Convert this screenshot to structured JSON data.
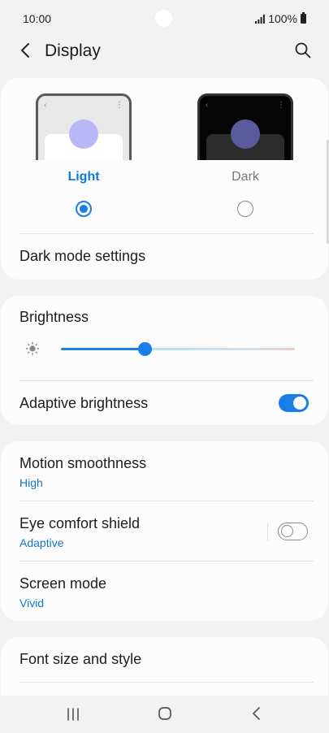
{
  "status_bar": {
    "time": "10:00",
    "battery": "100%",
    "icons": [
      "signal-icon",
      "battery-icon"
    ]
  },
  "app_bar": {
    "title": "Display",
    "icons": [
      "back-icon",
      "search-icon"
    ]
  },
  "theme": {
    "light_label": "Light",
    "dark_label": "Dark",
    "selected": "Light",
    "dark_mode_settings": "Dark mode settings"
  },
  "brightness": {
    "title": "Brightness",
    "level": 0.36,
    "adaptive_label": "Adaptive brightness",
    "adaptive_on": true
  },
  "settings": {
    "motion_smoothness": {
      "title": "Motion smoothness",
      "value": "High"
    },
    "eye_comfort": {
      "title": "Eye comfort shield",
      "value": "Adaptive",
      "on": false
    },
    "screen_mode": {
      "title": "Screen mode",
      "value": "Vivid"
    },
    "font_size": {
      "title": "Font size and style"
    }
  },
  "colors": {
    "accent": "#1a7ee8",
    "link": "#1177c9",
    "background": "#f2f2f2",
    "card": "#fcfcfc"
  }
}
